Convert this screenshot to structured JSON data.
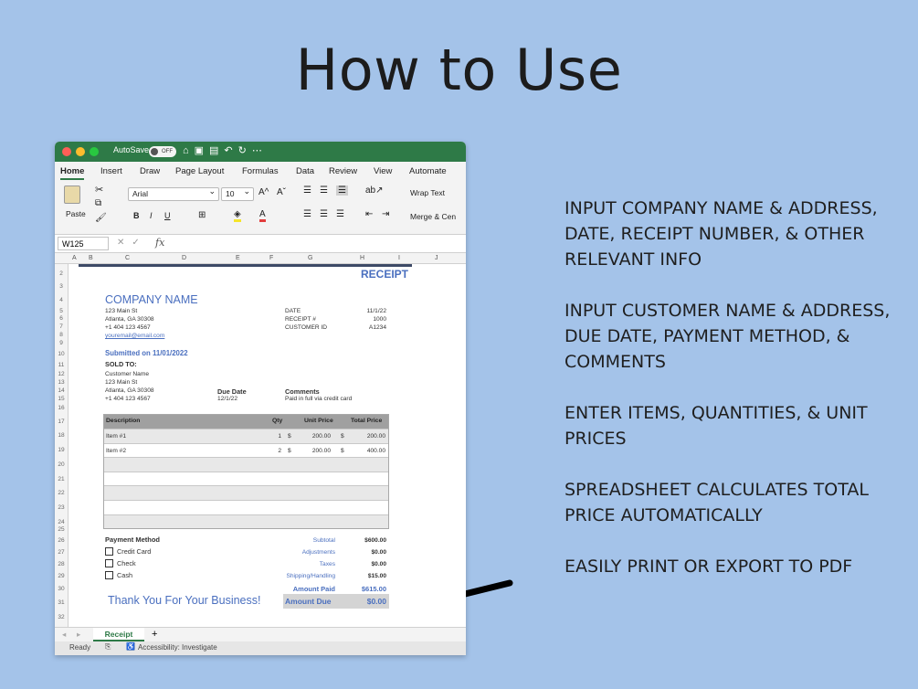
{
  "title": "How to Use",
  "instructions": [
    "INPUT COMPANY NAME & ADDRESS, DATE, RECEIPT NUMBER, & OTHER RELEVANT INFO",
    "INPUT CUSTOMER NAME & ADDRESS, DUE DATE, PAYMENT METHOD, & COMMENTS",
    "ENTER ITEMS, QUANTITIES, & UNIT PRICES",
    "SPREADSHEET CALCULATES TOTAL PRICE AUTOMATICALLY",
    "EASILY PRINT OR EXPORT TO PDF"
  ],
  "excel": {
    "autosave": "AutoSave",
    "autosave_state": "OFF",
    "menu": [
      "Home",
      "Insert",
      "Draw",
      "Page Layout",
      "Formulas",
      "Data",
      "Review",
      "View",
      "Automate"
    ],
    "ribbon": {
      "paste": "Paste",
      "font": "Arial",
      "size": "10",
      "wrap_text": "Wrap Text",
      "merge": "Merge & Cen"
    },
    "name_box": "W125",
    "fx": "fx",
    "columns": [
      "A",
      "B",
      "C",
      "D",
      "E",
      "F",
      "G",
      "H",
      "I",
      "J"
    ],
    "rows": [
      "2",
      "3",
      "4",
      "5",
      "6",
      "7",
      "8",
      "9",
      "10",
      "11",
      "12",
      "13",
      "14",
      "15",
      "16",
      "17",
      "18",
      "19",
      "20",
      "21",
      "22",
      "23",
      "24",
      "25",
      "26",
      "27",
      "28",
      "29",
      "30",
      "31",
      "32"
    ],
    "receipt": {
      "heading": "RECEIPT",
      "company_name": "COMPANY NAME",
      "company_address": [
        "123 Main St",
        "Atlanta, GA 30308",
        "+1 404 123 4567"
      ],
      "company_email": "youremail@email.com",
      "meta_labels": [
        "DATE",
        "RECEIPT #",
        "CUSTOMER ID"
      ],
      "meta_values": [
        "11/1/22",
        "1000",
        "A1234"
      ],
      "submitted": "Submitted on 11/01/2022",
      "sold_to": "SOLD TO:",
      "customer": [
        "Customer Name",
        "123 Main St",
        "Atlanta, GA 30308",
        "+1 404 123 4567"
      ],
      "due_date_label": "Due Date",
      "due_date": "12/1/22",
      "comments_label": "Comments",
      "comments": "Paid in full via credit card",
      "table_headers": [
        "Description",
        "Qty",
        "Unit Price",
        "Total Price"
      ],
      "items": [
        {
          "desc": "Item #1",
          "qty": "1",
          "cur": "$",
          "unit": "200.00",
          "cur2": "$",
          "total": "200.00"
        },
        {
          "desc": "Item #2",
          "qty": "2",
          "cur": "$",
          "unit": "200.00",
          "cur2": "$",
          "total": "400.00"
        }
      ],
      "payment_method": "Payment Method",
      "payment_options": [
        "Credit Card",
        "Check",
        "Cash"
      ],
      "summary_labels": [
        "Subtotal",
        "Adjustments",
        "Taxes",
        "Shipping/Handling"
      ],
      "summary_values": [
        "$600.00",
        "$0.00",
        "$0.00",
        "$15.00"
      ],
      "amount_paid_label": "Amount Paid",
      "amount_paid": "$615.00",
      "amount_due_label": "Amount Due",
      "amount_due": "$0.00",
      "thanks": "Thank You For Your Business!"
    },
    "sheet_tab": "Receipt",
    "add_sheet": "+",
    "status": "Ready",
    "accessibility": "Accessibility: Investigate"
  }
}
